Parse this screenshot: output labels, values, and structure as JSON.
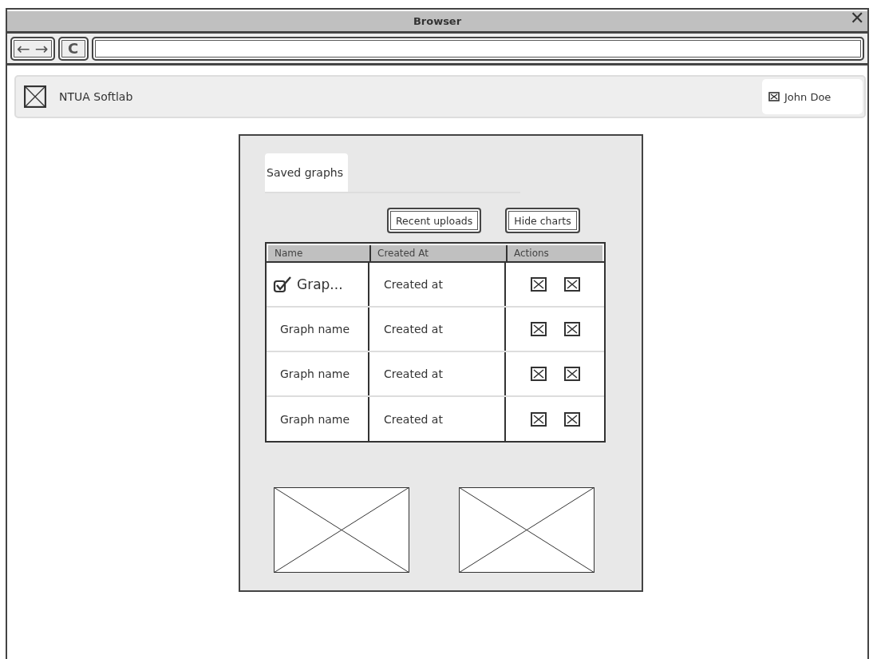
{
  "window": {
    "title": "Browser",
    "close": "✕"
  },
  "navigation": {
    "back": "←",
    "forward": "→",
    "reload": "C"
  },
  "header": {
    "brand": "NTUA Softlab",
    "user": "John Doe"
  },
  "tabs": [
    {
      "label": "Saved graphs",
      "selected": true
    }
  ],
  "buttons": [
    "Recent uploads",
    "Hide charts"
  ],
  "table": {
    "columns": [
      "Name",
      "Created At",
      "Actions"
    ],
    "rows": [
      {
        "name": "Grap...",
        "created": "Created at",
        "checked": true
      },
      {
        "name": "Graph name",
        "created": "Created at",
        "checked": false
      },
      {
        "name": "Graph name",
        "created": "Created at",
        "checked": false
      },
      {
        "name": "Graph name",
        "created": "Created at",
        "checked": false
      }
    ]
  },
  "charts": [
    {
      "kind": "picture"
    },
    {
      "kind": "picture"
    }
  ]
}
